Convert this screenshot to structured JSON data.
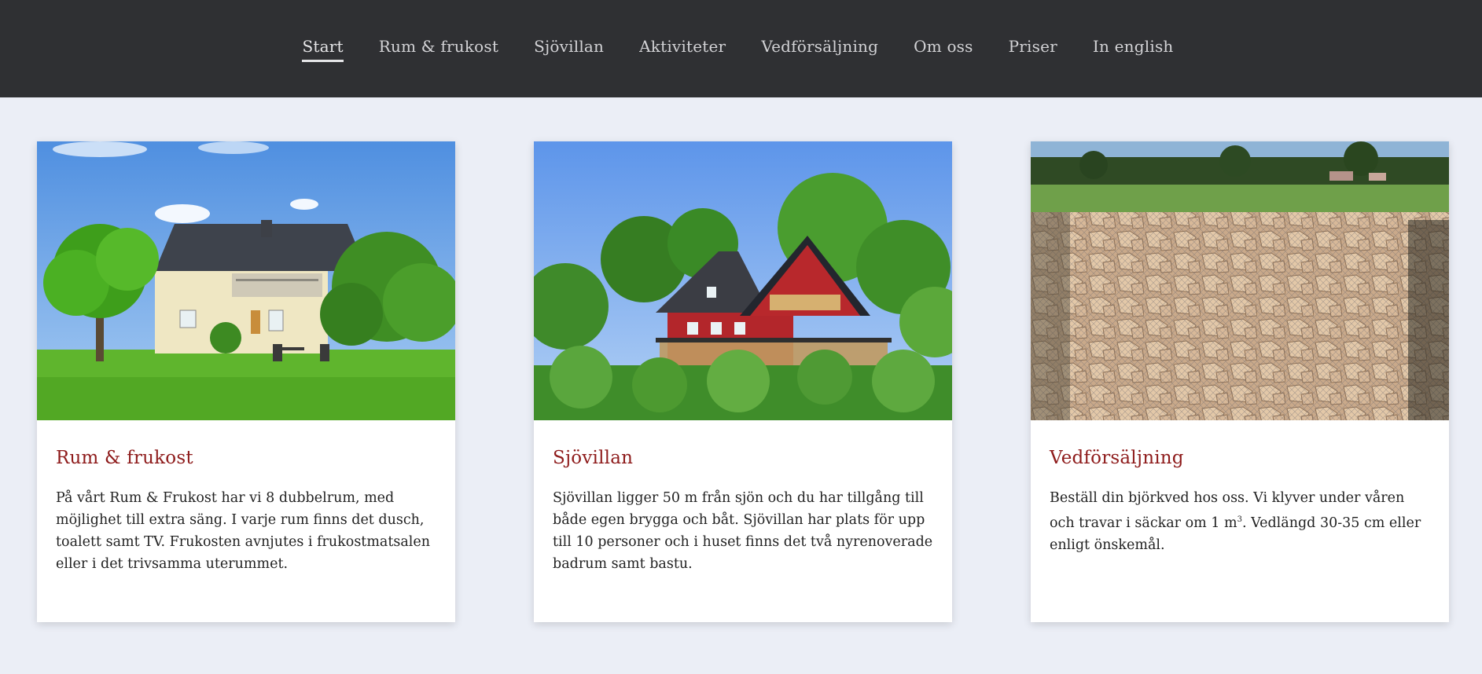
{
  "nav": {
    "items": [
      {
        "label": "Start",
        "active": true
      },
      {
        "label": "Rum & frukost",
        "active": false
      },
      {
        "label": "Sjövillan",
        "active": false
      },
      {
        "label": "Aktiviteter",
        "active": false
      },
      {
        "label": "Vedförsäljning",
        "active": false
      },
      {
        "label": "Om oss",
        "active": false
      },
      {
        "label": "Priser",
        "active": false
      },
      {
        "label": "In english",
        "active": false
      }
    ]
  },
  "cards": [
    {
      "title": "Rum & frukost",
      "text": "På vårt Rum & Frukost har vi 8 dubbelrum, med möjlighet till extra säng. I varje rum finns det dusch, toalett samt TV. Frukosten avnjutes i frukostmatsalen eller i det trivsamma uterummet.",
      "image": "yellow-house-photo"
    },
    {
      "title": "Sjövillan",
      "text": "Sjövillan ligger 50 m från sjön och du har tillgång till både egen brygga och båt. Sjövillan har plats för upp till 10 personer och i huset finns det två nyrenoverade badrum samt bastu.",
      "image": "red-villa-photo"
    },
    {
      "title": "Vedförsäljning",
      "text_before": "Beställ din björkved hos oss. Vi klyver under våren och travar i säckar om 1 m",
      "text_sup": "3",
      "text_after": ". Vedlängd 30-35 cm eller enligt önskemål.",
      "image": "firewood-photo"
    }
  ],
  "colors": {
    "nav_bg": "#2f3033",
    "page_bg": "#ebeef6",
    "title_accent": "#8e1b1b"
  }
}
